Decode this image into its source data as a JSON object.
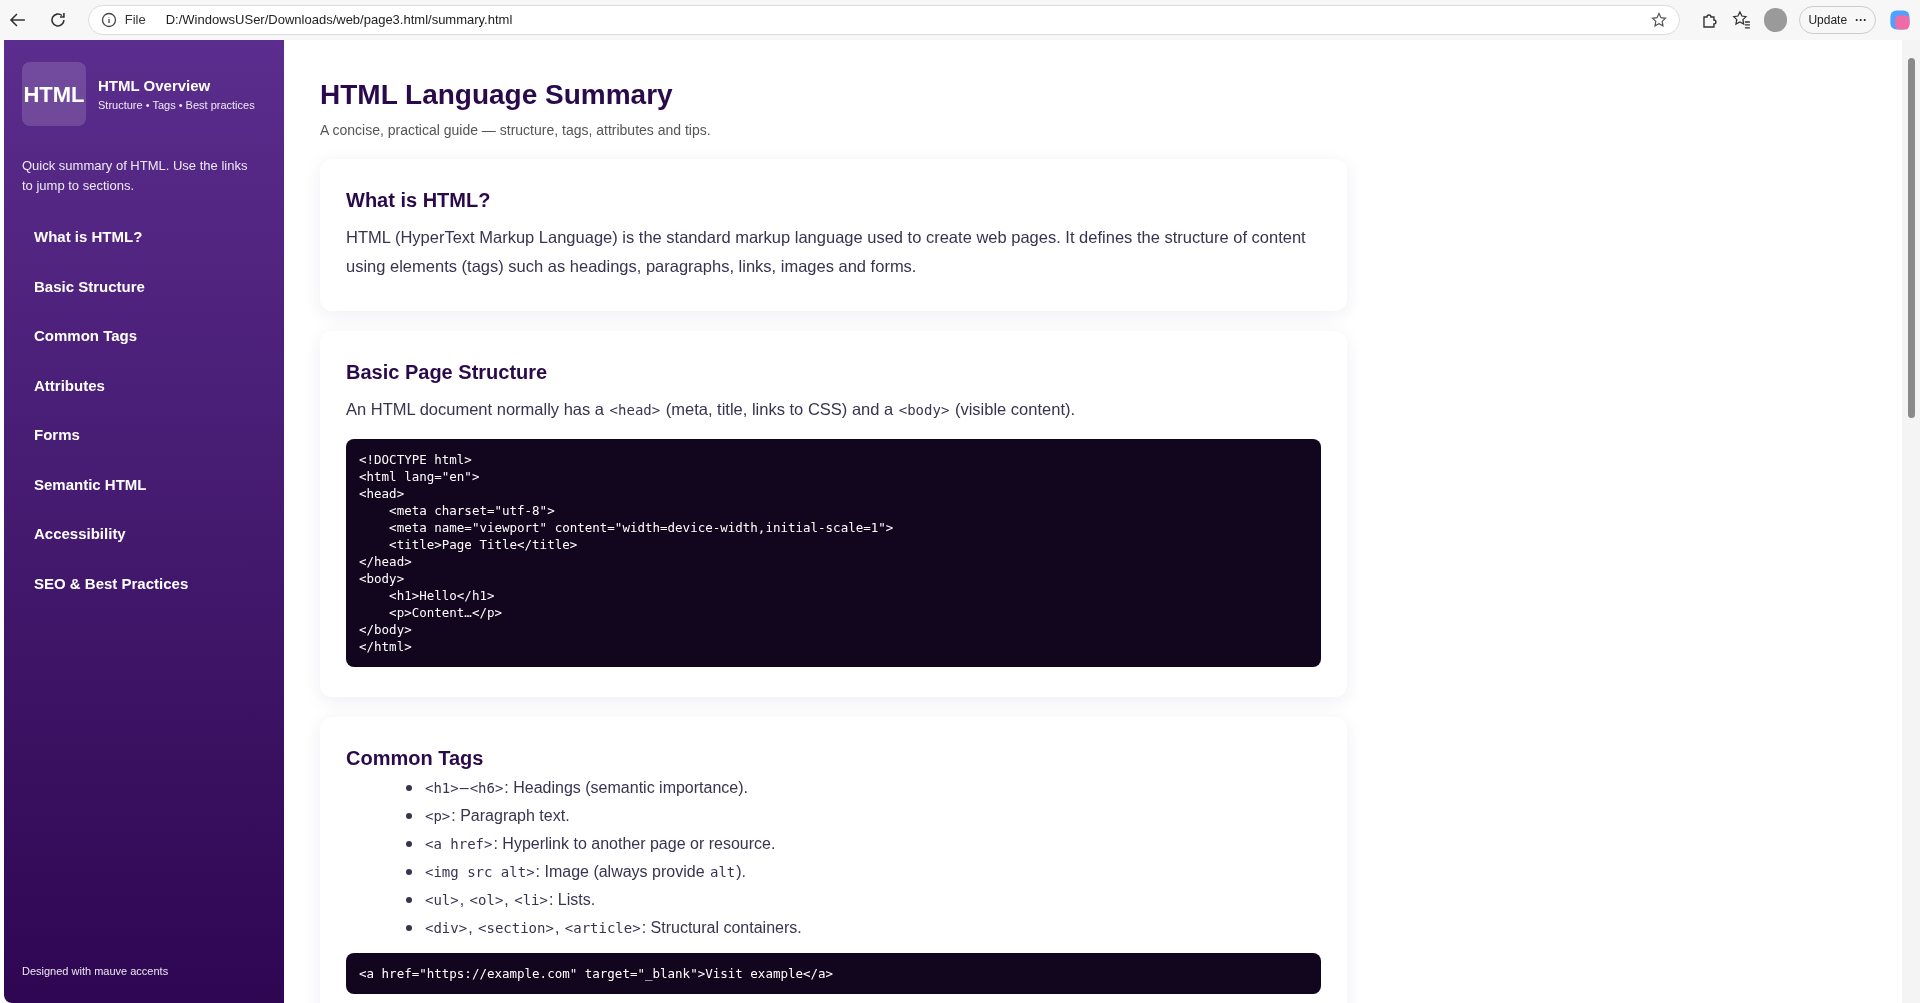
{
  "browser": {
    "file_label": "File",
    "url": "D:/WindowsUSer/Downloads/web/page3.html/summary.html",
    "update_button": "Update",
    "more_button": "···"
  },
  "sidebar": {
    "logo": "HTML",
    "title": "HTML Overview",
    "subtitle": "Structure • Tags • Best practices",
    "intro": "Quick summary of HTML. Use the links to jump to sections.",
    "items": [
      "What is HTML?",
      "Basic Structure",
      "Common Tags",
      "Attributes",
      "Forms",
      "Semantic HTML",
      "Accessibility",
      "SEO & Best Practices"
    ],
    "footer": "Designed with mauve accents"
  },
  "page": {
    "title": "HTML Language Summary",
    "subtitle": "A concise, practical guide — structure, tags, attributes and tips."
  },
  "sections": [
    {
      "heading": "What is HTML?",
      "paragraph": [
        {
          "kind": "text",
          "text": "HTML (HyperText Markup Language) is the standard markup language used to create web pages. It defines the structure of content using elements (tags) such as headings, paragraphs, links, images and forms."
        }
      ]
    },
    {
      "heading": "Basic Page Structure",
      "paragraph": [
        {
          "kind": "text",
          "text": "An HTML document normally has a "
        },
        {
          "kind": "code",
          "text": "<head>"
        },
        {
          "kind": "text",
          "text": " (meta, title, links to CSS) and a "
        },
        {
          "kind": "code",
          "text": "<body>"
        },
        {
          "kind": "text",
          "text": " (visible content)."
        }
      ],
      "code": "<!DOCTYPE html>\n<html lang=\"en\">\n<head>\n    <meta charset=\"utf-8\">\n    <meta name=\"viewport\" content=\"width=device-width,initial-scale=1\">\n    <title>Page Title</title>\n</head>\n<body>\n    <h1>Hello</h1>\n    <p>Content…</p>\n</body>\n</html>"
    },
    {
      "heading": "Common Tags",
      "list": [
        [
          {
            "kind": "code",
            "text": "<h1>"
          },
          {
            "kind": "text",
            "text": "–"
          },
          {
            "kind": "code",
            "text": "<h6>"
          },
          {
            "kind": "text",
            "text": ": Headings (semantic importance)."
          }
        ],
        [
          {
            "kind": "code",
            "text": "<p>"
          },
          {
            "kind": "text",
            "text": ": Paragraph text."
          }
        ],
        [
          {
            "kind": "code",
            "text": "<a href>"
          },
          {
            "kind": "text",
            "text": ": Hyperlink to another page or resource."
          }
        ],
        [
          {
            "kind": "code",
            "text": "<img src alt>"
          },
          {
            "kind": "text",
            "text": ": Image (always provide "
          },
          {
            "kind": "code",
            "text": "alt"
          },
          {
            "kind": "text",
            "text": ")."
          }
        ],
        [
          {
            "kind": "code",
            "text": "<ul>"
          },
          {
            "kind": "text",
            "text": ", "
          },
          {
            "kind": "code",
            "text": "<ol>"
          },
          {
            "kind": "text",
            "text": ", "
          },
          {
            "kind": "code",
            "text": "<li>"
          },
          {
            "kind": "text",
            "text": ": Lists."
          }
        ],
        [
          {
            "kind": "code",
            "text": "<div>"
          },
          {
            "kind": "text",
            "text": ", "
          },
          {
            "kind": "code",
            "text": "<section>"
          },
          {
            "kind": "text",
            "text": ", "
          },
          {
            "kind": "code",
            "text": "<article>"
          },
          {
            "kind": "text",
            "text": ": Structural containers."
          }
        ]
      ],
      "code": "<a href=\"https://example.com\" target=\"_blank\">Visit example</a>"
    }
  ]
}
